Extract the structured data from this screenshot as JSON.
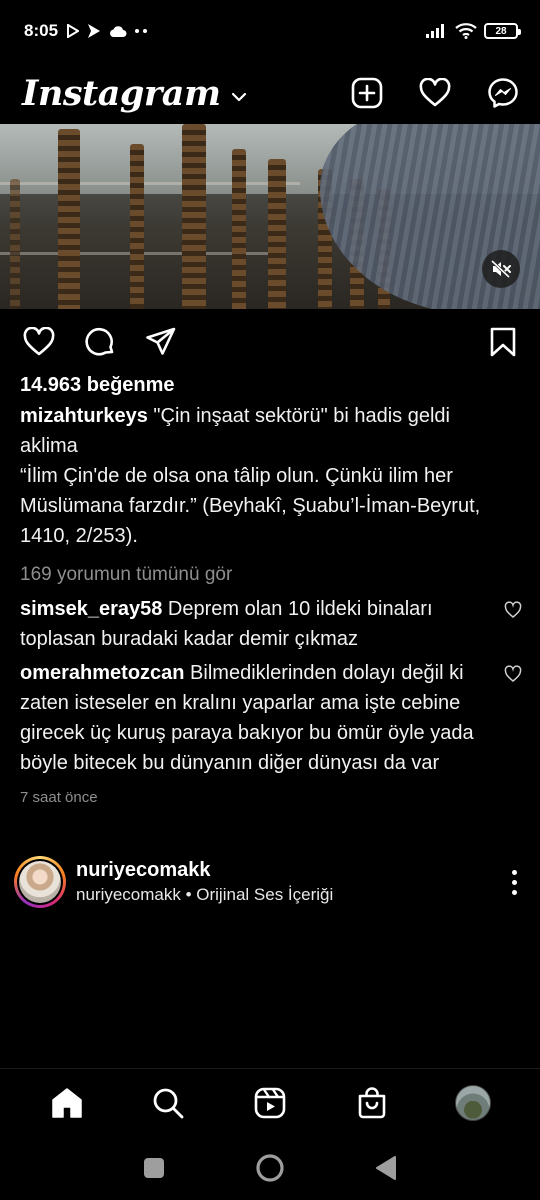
{
  "status_bar": {
    "time": "8:05",
    "battery": "28",
    "left_icons": [
      "play-icon",
      "app-icon",
      "cloud-icon",
      "more-dots-icon"
    ],
    "right_icons": [
      "signal-icon",
      "wifi-icon",
      "battery-icon"
    ]
  },
  "header": {
    "brand": "Instagram",
    "actions": [
      "new-post-icon",
      "heart-icon",
      "messenger-icon"
    ]
  },
  "post": {
    "likes": "14.963 beğenme",
    "caption": {
      "username": "mizahturkeys",
      "text": " \"Çin inşaat sektörü\" bi hadis geldi aklima\n“İlim Çin'de de olsa ona tâlip olun. Çünkü ilim her Müslümana farzdır.” (Beyhakî, Şuabu’l-İman-Beyrut, 1410, 2/253)."
    },
    "view_comments": "169 yorumun tümünü gör",
    "comments": [
      {
        "username": "simsek_eray58",
        "text": " Deprem olan 10 ildeki binaları toplasan buradaki kadar demir çıkmaz"
      },
      {
        "username": "omerahmetozcan",
        "text": " Bilmediklerinden dolayı değil ki zaten isteseler en kralını yaparlar ama işte cebine girecek üç kuruş paraya bakıyor bu ömür öyle yada böyle bitecek bu dünyanın diğer dünyası da var"
      }
    ],
    "timestamp": "7 saat önce"
  },
  "next_post": {
    "username": "nuriyecomakk",
    "subtitle": "nuriyecomakk • Orijinal Ses İçeriği"
  },
  "bottom_nav": [
    "home-icon",
    "search-icon",
    "reels-icon",
    "shop-icon",
    "profile-avatar"
  ],
  "system_nav": [
    "recents-icon",
    "home-circle-icon",
    "back-icon"
  ]
}
